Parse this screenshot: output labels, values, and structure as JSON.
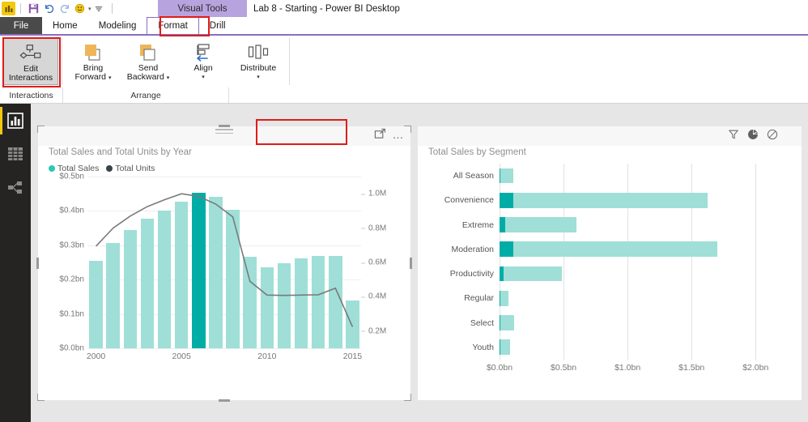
{
  "titlebar": {
    "app_icon": "powerbi-logo-icon",
    "quick_access": [
      {
        "name": "save-icon",
        "glyph": "💾"
      },
      {
        "name": "undo-icon",
        "glyph": "↶"
      },
      {
        "name": "redo-icon",
        "glyph": "↷"
      },
      {
        "name": "smiley-feedback-icon",
        "glyph": "☺"
      }
    ],
    "caret": "▾",
    "customize_glyph": "═",
    "contextual_tab_group": "Visual Tools",
    "window_title": "Lab 8 - Starting - Power BI Desktop"
  },
  "ribbon": {
    "tabs": [
      {
        "label": "File",
        "active": false
      },
      {
        "label": "Home",
        "active": false
      },
      {
        "label": "Modeling",
        "active": false
      },
      {
        "label": "Format",
        "active": true
      },
      {
        "label": "Drill",
        "active": false
      }
    ],
    "buttons": {
      "edit_interactions": {
        "line1": "Edit",
        "line2": "Interactions"
      },
      "bring_forward": {
        "line1": "Bring",
        "line2": "Forward"
      },
      "send_backward": {
        "line1": "Send",
        "line2": "Backward"
      },
      "align": {
        "line1": "Align",
        "line2": ""
      },
      "distribute": {
        "line1": "Distribute",
        "line2": ""
      }
    },
    "group_labels": {
      "interactions": "Interactions",
      "arrange": "Arrange"
    },
    "highlight_color": "#e01b1b"
  },
  "sidebar": {
    "items": [
      {
        "name": "report-view",
        "icon": "bar-chart-icon",
        "active": true
      },
      {
        "name": "data-view",
        "icon": "table-grid-icon",
        "active": false
      },
      {
        "name": "model-view",
        "icon": "relationships-icon",
        "active": false
      }
    ]
  },
  "visuals": {
    "combo": {
      "title": "Total Sales and Total Units by Year",
      "focus_icon": "focus-mode-icon",
      "more_icon": "more-options-icon"
    },
    "segment": {
      "title": "Total Sales by Segment",
      "interaction_icons": [
        {
          "name": "filter-funnel-icon",
          "label": "Filter"
        },
        {
          "name": "highlight-pie-icon",
          "label": "Highlight"
        },
        {
          "name": "no-interaction-icon",
          "label": "None"
        }
      ]
    }
  },
  "colors": {
    "bar_light": "#9fdfd7",
    "bar_dark": "#00ada6",
    "line": "#7a7a7a",
    "accent_purple": "#8a6fc0",
    "brand_yellow": "#f2c811"
  },
  "chart_data": [
    {
      "type": "bar",
      "id": "combo-chart",
      "title": "Total Sales and Total Units by Year",
      "xlabel": "",
      "ylabel": "",
      "grid": true,
      "legend_position": "top-left",
      "legend": [
        {
          "name": "Total Sales",
          "color": "#2dc7b8"
        },
        {
          "name": "Total Units",
          "color": "#3a4347"
        }
      ],
      "categories": [
        2000,
        2001,
        2002,
        2003,
        2004,
        2005,
        2006,
        2007,
        2008,
        2009,
        2010,
        2011,
        2012,
        2013,
        2014,
        2015
      ],
      "xtick_labels": [
        "2000",
        "2005",
        "2010",
        "2015"
      ],
      "ylim": [
        0,
        0.5
      ],
      "ytick_labels": [
        "$0.0bn",
        "$0.1bn",
        "$0.2bn",
        "$0.3bn",
        "$0.4bn",
        "$0.5bn"
      ],
      "y2lim": [
        0.1,
        1.1
      ],
      "y2tick_labels": [
        "0.2M",
        "0.4M",
        "0.6M",
        "0.8M",
        "1.0M"
      ],
      "series": [
        {
          "name": "Total Sales",
          "type": "bar",
          "axis": "left",
          "values": [
            0.255,
            0.307,
            0.345,
            0.377,
            0.4,
            0.428,
            0.452,
            0.44,
            0.404,
            0.266,
            0.235,
            0.248,
            0.261,
            0.27,
            0.27,
            0.139
          ],
          "highlighted_index": 6
        },
        {
          "name": "Total Units",
          "type": "line",
          "axis": "right",
          "values": [
            0.695,
            0.8,
            0.87,
            0.925,
            0.965,
            1.0,
            0.985,
            0.94,
            0.865,
            0.49,
            0.41,
            0.408,
            0.41,
            0.412,
            0.45,
            0.225
          ]
        }
      ]
    },
    {
      "type": "bar",
      "id": "segment-chart",
      "orientation": "horizontal",
      "title": "Total Sales by Segment",
      "xlabel": "",
      "ylabel": "",
      "grid": true,
      "categories": [
        "All Season",
        "Convenience",
        "Extreme",
        "Moderation",
        "Productivity",
        "Regular",
        "Select",
        "Youth"
      ],
      "xlim": [
        0,
        2.15
      ],
      "xtick_labels": [
        "$0.0bn",
        "$0.5bn",
        "$1.0bn",
        "$1.5bn",
        "$2.0bn"
      ],
      "xtick_values": [
        0,
        0.5,
        1.0,
        1.5,
        2.0
      ],
      "series": [
        {
          "name": "Total Sales",
          "values": [
            0.105,
            1.625,
            0.6,
            1.7,
            0.485,
            0.07,
            0.115,
            0.083
          ]
        },
        {
          "name": "Total Sales (highlighted)",
          "values": [
            0.008,
            0.107,
            0.045,
            0.105,
            0.033,
            0.004,
            0.006,
            0.005
          ]
        }
      ]
    }
  ]
}
